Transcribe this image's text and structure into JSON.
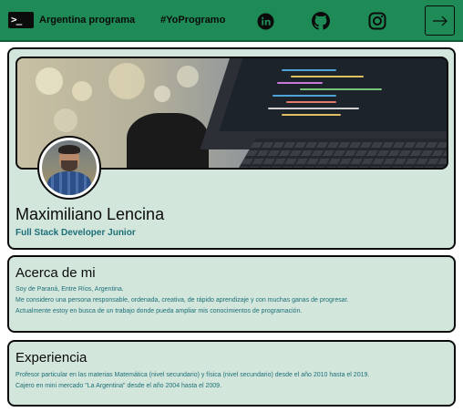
{
  "header": {
    "logo_glyph": ">_",
    "brand": "Argentina programa",
    "hashtag": "#YoProgramo",
    "social_icons": [
      "linkedin-icon",
      "github-icon",
      "instagram-icon"
    ],
    "login_icon": "arrow-right-icon",
    "colors": {
      "navbar": "#1e8a55",
      "text": "#0b0b0b"
    }
  },
  "profile": {
    "name": "Maximiliano Lencina",
    "title": "Full Stack Developer Junior"
  },
  "about": {
    "heading": "Acerca de mi",
    "lines": [
      "Soy de Paraná, Entre Ríos, Argentina.",
      "Me considero una persona responsable, ordenada, creativa, de rápido aprendizaje y con muchas ganas de progresar.",
      "Actualmente estoy en busca de un trabajo donde pueda ampliar mis conocimientos de programación."
    ]
  },
  "experience": {
    "heading": "Experiencia",
    "lines": [
      "Profesor particular en las materias Matemática (nivel secundario) y física (nivel secundario) desde el año 2010 hasta el 2019.",
      "Cajero en mini mercado \"La Argentina\" desde el año 2004 hasta el 2009."
    ]
  },
  "theme": {
    "card_bg": "#d2e6dc",
    "accent_text": "#1d6f78"
  }
}
